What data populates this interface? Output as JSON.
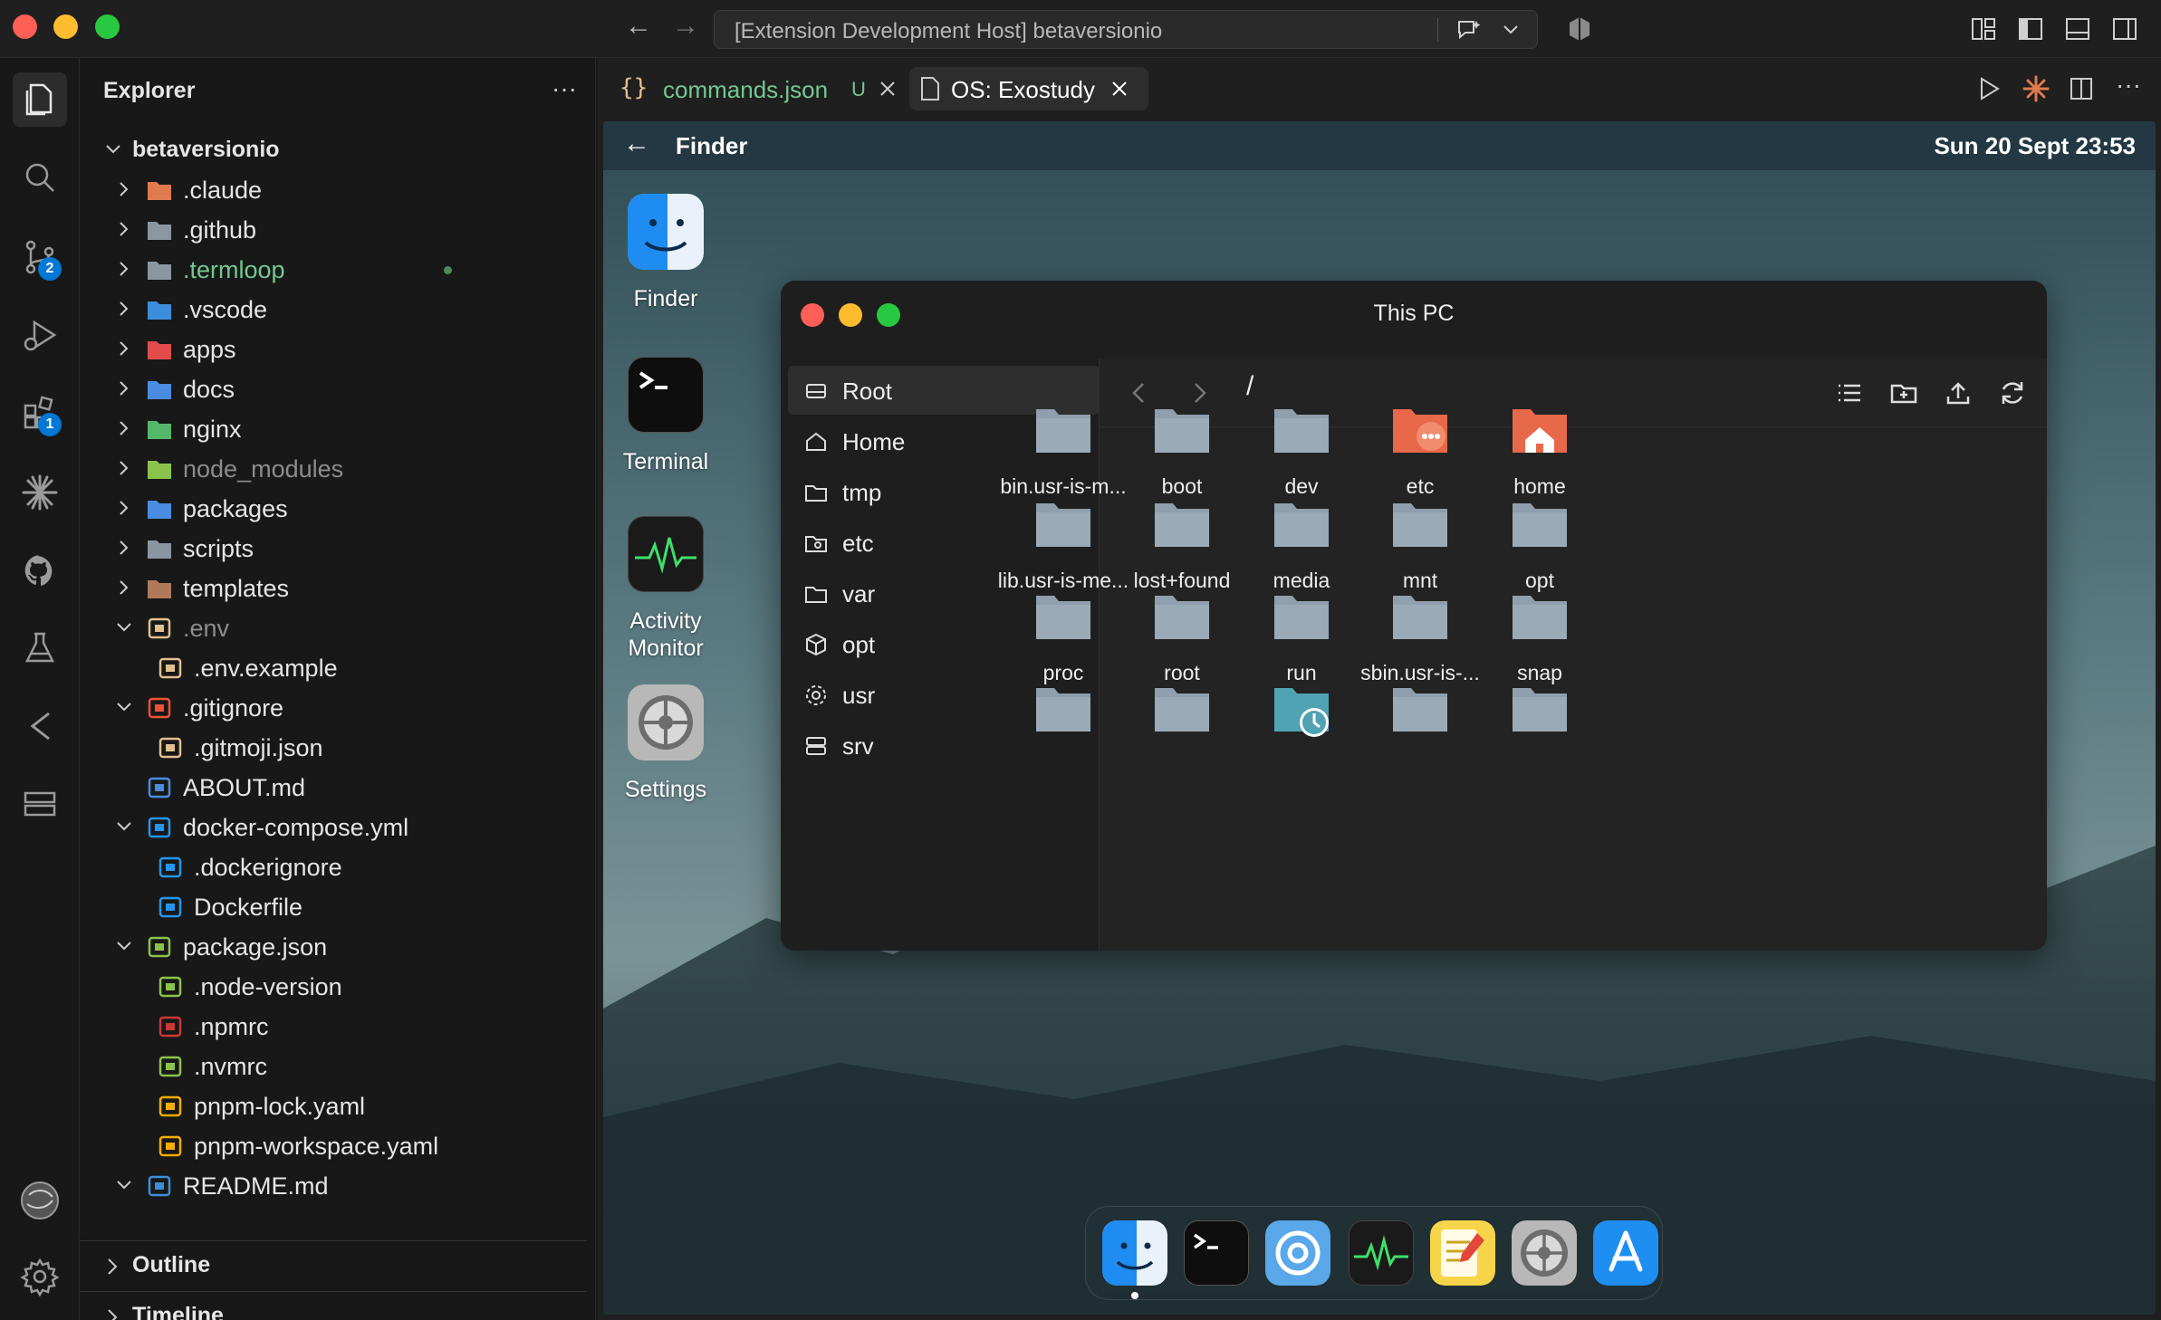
{
  "window": {
    "command_center_text": "[Extension Development Host] betaversionio"
  },
  "activity_bar": {
    "source_control_badge": "2",
    "extensions_badge": "1"
  },
  "explorer": {
    "title": "Explorer",
    "more_label": "···",
    "workspace": "betaversionio",
    "items": [
      {
        "label": ".claude",
        "icon": "claude-folder-icon"
      },
      {
        "label": ".github",
        "icon": "github-folder-icon"
      },
      {
        "label": ".termloop",
        "icon": "folder-icon"
      },
      {
        "label": ".vscode",
        "icon": "vscode-folder-icon"
      },
      {
        "label": "apps",
        "icon": "apps-folder-icon"
      },
      {
        "label": "docs",
        "icon": "docs-folder-icon"
      },
      {
        "label": "nginx",
        "icon": "nginx-folder-icon"
      },
      {
        "label": "node_modules",
        "icon": "node-folder-icon"
      },
      {
        "label": "packages",
        "icon": "packages-folder-icon"
      },
      {
        "label": "scripts",
        "icon": "scripts-folder-icon"
      },
      {
        "label": "templates",
        "icon": "templates-folder-icon"
      },
      {
        "label": ".env",
        "icon": "env-icon"
      },
      {
        "label": ".env.example",
        "icon": "env-icon"
      },
      {
        "label": ".gitignore",
        "icon": "git-icon"
      },
      {
        "label": ".gitmoji.json",
        "icon": "json-icon"
      },
      {
        "label": "ABOUT.md",
        "icon": "markdown-icon"
      },
      {
        "label": "docker-compose.yml",
        "icon": "docker-icon"
      },
      {
        "label": ".dockerignore",
        "icon": "docker-icon"
      },
      {
        "label": "Dockerfile",
        "icon": "docker-icon"
      },
      {
        "label": "package.json",
        "icon": "nodejs-icon"
      },
      {
        "label": ".node-version",
        "icon": "nodejs-icon"
      },
      {
        "label": ".npmrc",
        "icon": "npm-icon"
      },
      {
        "label": ".nvmrc",
        "icon": "nodejs-icon"
      },
      {
        "label": "pnpm-lock.yaml",
        "icon": "pnpm-icon"
      },
      {
        "label": "pnpm-workspace.yaml",
        "icon": "pnpm-icon"
      },
      {
        "label": "README.md",
        "icon": "info-icon"
      }
    ],
    "outline_label": "Outline",
    "timeline_label": "Timeline"
  },
  "tabs": [
    {
      "label": "commands.json",
      "status": "U"
    },
    {
      "label": "OS: Exostudy"
    }
  ],
  "webview": {
    "title": "Finder",
    "clock": "Sun 20 Sept 23:53",
    "desktop_icons": [
      "Finder",
      "Terminal",
      "Activity Monitor",
      "Settings"
    ]
  },
  "finder_window": {
    "title": "This PC",
    "path": "/",
    "sidebar": [
      "Root",
      "Home",
      "tmp",
      "etc",
      "var",
      "opt",
      "usr",
      "srv"
    ],
    "items": [
      "bin.usr-is-m...",
      "boot",
      "dev",
      "etc",
      "home",
      "lib.usr-is-me...",
      "lost+found",
      "media",
      "mnt",
      "opt",
      "proc",
      "root",
      "run",
      "sbin.usr-is-...",
      "snap",
      "",
      "",
      "",
      "",
      ""
    ]
  },
  "dock": [
    "Finder",
    "Terminal",
    "Browser",
    "Activity Monitor",
    "Notes",
    "Settings",
    "App Store"
  ],
  "colors": {
    "accent": "#0078d4",
    "untracked_green": "#73c991",
    "folder": "#8f9fae",
    "close": "#ff5f57",
    "minimize": "#febc2e",
    "zoom": "#28c840"
  }
}
